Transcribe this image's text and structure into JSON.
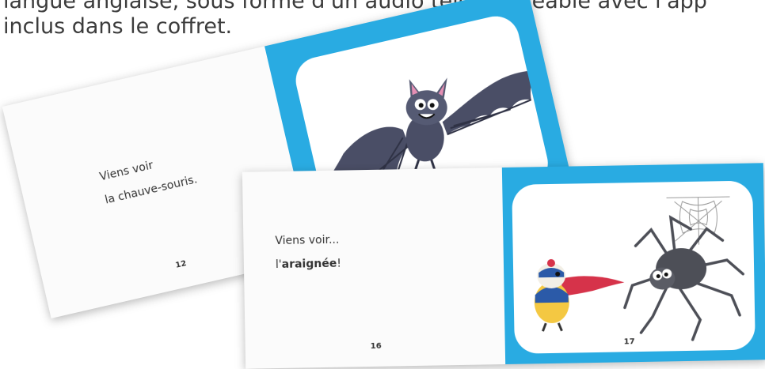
{
  "intro": {
    "line1": "langue anglaise, sous forme d'un audio téléchargeable avec l'app",
    "line2": "inclus dans le coffret."
  },
  "book_back": {
    "text_line1": "Viens voir",
    "text_line2": "la chauve-souris.",
    "page_number": "12",
    "illustration": "bat-illustration"
  },
  "book_front": {
    "text_line1": "Viens voir...",
    "text_prefix": "l'",
    "text_bold": "araignée",
    "text_suffix": "!",
    "page_number_left": "16",
    "page_number_right": "17",
    "illustration": "spider-illustration"
  },
  "colors": {
    "page_blue": "#29abe2",
    "bat": "#4a4e66",
    "spider": "#4d4f57"
  }
}
